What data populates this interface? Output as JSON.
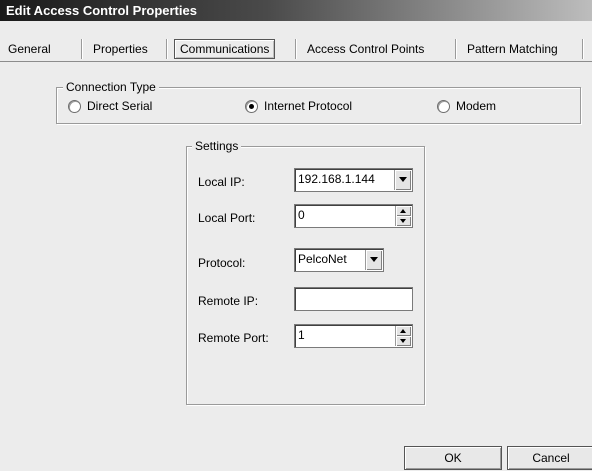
{
  "window": {
    "title": "Edit Access Control Properties"
  },
  "tabs": [
    {
      "label": "General"
    },
    {
      "label": "Properties"
    },
    {
      "label": "Communications",
      "active": true
    },
    {
      "label": "Access Control Points"
    },
    {
      "label": "Pattern Matching"
    }
  ],
  "connection_type": {
    "legend": "Connection Type",
    "options": [
      {
        "label": "Direct Serial",
        "checked": false
      },
      {
        "label": "Internet Protocol",
        "checked": true
      },
      {
        "label": "Modem",
        "checked": false
      }
    ]
  },
  "settings": {
    "legend": "Settings",
    "local_ip": {
      "label": "Local IP:",
      "value": "192.168.1.144"
    },
    "local_port": {
      "label": "Local Port:",
      "value": "0"
    },
    "protocol": {
      "label": "Protocol:",
      "value": "PelcoNet"
    },
    "remote_ip": {
      "label": "Remote IP:",
      "value": ""
    },
    "remote_port": {
      "label": "Remote Port:",
      "value": "1"
    }
  },
  "buttons": {
    "ok": "OK",
    "cancel": "Cancel"
  }
}
